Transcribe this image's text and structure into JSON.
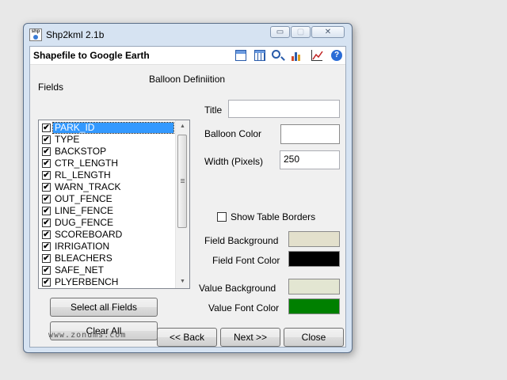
{
  "window": {
    "title": "Shp2kml 2.1b",
    "app_icon_text": "shp",
    "controls": {
      "minimize": "▭",
      "maximize": "▢",
      "close": "✕"
    }
  },
  "header": {
    "title": "Shapefile to Google Earth",
    "toolbar_icons": [
      "window-icon",
      "table-icon",
      "zoom-icon",
      "bar-chart-icon",
      "line-chart-icon",
      "help-icon"
    ],
    "help_glyph": "?"
  },
  "section_title": "Balloon Definiition",
  "fields_label": "Fields",
  "fields": [
    {
      "name": "PARK_ID",
      "checked": true,
      "selected": true
    },
    {
      "name": "TYPE",
      "checked": true,
      "selected": false
    },
    {
      "name": "BACKSTOP",
      "checked": true,
      "selected": false
    },
    {
      "name": "CTR_LENGTH",
      "checked": true,
      "selected": false
    },
    {
      "name": "RL_LENGTH",
      "checked": true,
      "selected": false
    },
    {
      "name": "WARN_TRACK",
      "checked": true,
      "selected": false
    },
    {
      "name": "OUT_FENCE",
      "checked": true,
      "selected": false
    },
    {
      "name": "LINE_FENCE",
      "checked": true,
      "selected": false
    },
    {
      "name": "DUG_FENCE",
      "checked": true,
      "selected": false
    },
    {
      "name": "SCOREBOARD",
      "checked": true,
      "selected": false
    },
    {
      "name": "IRRIGATION",
      "checked": true,
      "selected": false
    },
    {
      "name": "BLEACHERS",
      "checked": true,
      "selected": false
    },
    {
      "name": "SAFE_NET",
      "checked": true,
      "selected": false
    },
    {
      "name": "PLYERBENCH",
      "checked": true,
      "selected": false
    }
  ],
  "check_glyph": "✔",
  "scroll": {
    "up": "▲",
    "down": "▼"
  },
  "form": {
    "title_label": "Title",
    "title_value": "",
    "balloon_color_label": "Balloon Color",
    "balloon_color": "#ffffff",
    "width_label": "Width (Pixels)",
    "width_value": "250",
    "show_table_borders_label": "Show Table Borders",
    "show_table_borders": false,
    "field_background_label": "Field Background",
    "field_background_color": "#e3e0cc",
    "field_font_color_label": "Field Font Color",
    "field_font_color": "#000000",
    "value_background_label": "Value Background",
    "value_background_color": "#e3e6d2",
    "value_font_color_label": "Value Font Color",
    "value_font_color": "#008000"
  },
  "buttons": {
    "select_all": "Select all Fields",
    "clear_all": "Clear All",
    "back": "<< Back",
    "next": "Next >>",
    "close": "Close"
  },
  "watermark": "www.zonums.com"
}
